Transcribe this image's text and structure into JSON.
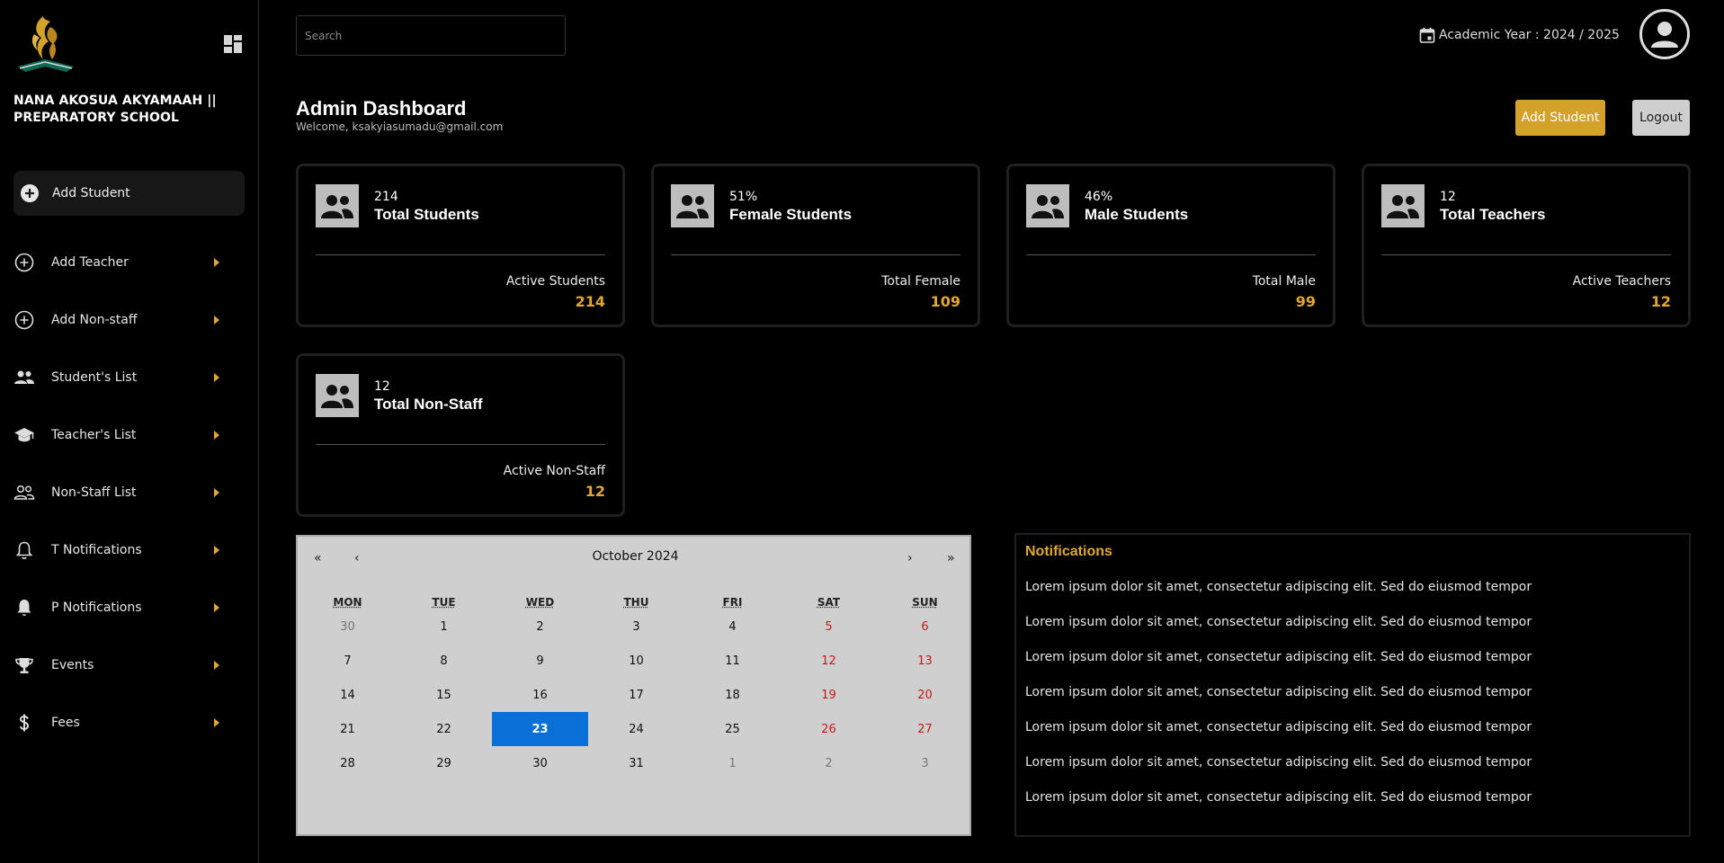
{
  "sidebar": {
    "school_name": "NANA AKOSUA AKYAMAAH || PREPARATORY SCHOOL",
    "primary_label": "Add Student",
    "items": [
      {
        "label": "Add Teacher",
        "icon": "add-circle-icon"
      },
      {
        "label": "Add Non-staff",
        "icon": "add-circle-icon"
      },
      {
        "label": "Student's List",
        "icon": "people-icon"
      },
      {
        "label": "Teacher's List",
        "icon": "graduation-cap-icon"
      },
      {
        "label": "Non-Staff List",
        "icon": "people-outline-icon"
      },
      {
        "label": "T Notifications",
        "icon": "bell-outline-icon"
      },
      {
        "label": "P Notifications",
        "icon": "bell-icon"
      },
      {
        "label": "Events",
        "icon": "trophy-icon"
      },
      {
        "label": "Fees",
        "icon": "dollar-icon"
      }
    ],
    "accent": "#e0a82e"
  },
  "header": {
    "search_placeholder": "Search",
    "academic_year": "Academic Year : 2024 / 2025"
  },
  "page": {
    "title": "Admin Dashboard",
    "welcome": "Welcome, ksakyiasumadu@gmail.com",
    "add_student_label": "Add Student",
    "logout_label": "Logout"
  },
  "stats": [
    {
      "value": "214",
      "label": "Total Students",
      "sub_label": "Active Students",
      "sub_value": "214"
    },
    {
      "value": "51%",
      "label": "Female Students",
      "sub_label": "Total Female",
      "sub_value": "109"
    },
    {
      "value": "46%",
      "label": "Male Students",
      "sub_label": "Total Male",
      "sub_value": "99"
    },
    {
      "value": "12",
      "label": "Total Teachers",
      "sub_label": "Active Teachers",
      "sub_value": "12"
    },
    {
      "value": "12",
      "label": "Total Non-Staff",
      "sub_label": "Active Non-Staff",
      "sub_value": "12"
    }
  ],
  "calendar": {
    "month": "October 2024",
    "nav": {
      "prev_year": "«",
      "prev_month": "‹",
      "next_month": "›",
      "next_year": "»"
    },
    "weekdays": [
      "MON",
      "TUE",
      "WED",
      "THU",
      "FRI",
      "SAT",
      "SUN"
    ],
    "weeks": [
      [
        "30",
        "1",
        "2",
        "3",
        "4",
        "5",
        "6"
      ],
      [
        "7",
        "8",
        "9",
        "10",
        "11",
        "12",
        "13"
      ],
      [
        "14",
        "15",
        "16",
        "17",
        "18",
        "19",
        "20"
      ],
      [
        "21",
        "22",
        "23",
        "24",
        "25",
        "26",
        "27"
      ],
      [
        "28",
        "29",
        "30",
        "31",
        "1",
        "2",
        "3"
      ]
    ],
    "selected_day": "23",
    "selected_color": "#0a6fd6"
  },
  "notifications": {
    "title": "Notifications",
    "items": [
      "Lorem ipsum dolor sit amet, consectetur adipiscing elit. Sed do eiusmod tempor",
      "Lorem ipsum dolor sit amet, consectetur adipiscing elit. Sed do eiusmod tempor",
      "Lorem ipsum dolor sit amet, consectetur adipiscing elit. Sed do eiusmod tempor",
      "Lorem ipsum dolor sit amet, consectetur adipiscing elit. Sed do eiusmod tempor",
      "Lorem ipsum dolor sit amet, consectetur adipiscing elit. Sed do eiusmod tempor",
      "Lorem ipsum dolor sit amet, consectetur adipiscing elit. Sed do eiusmod tempor",
      "Lorem ipsum dolor sit amet, consectetur adipiscing elit. Sed do eiusmod tempor"
    ]
  }
}
